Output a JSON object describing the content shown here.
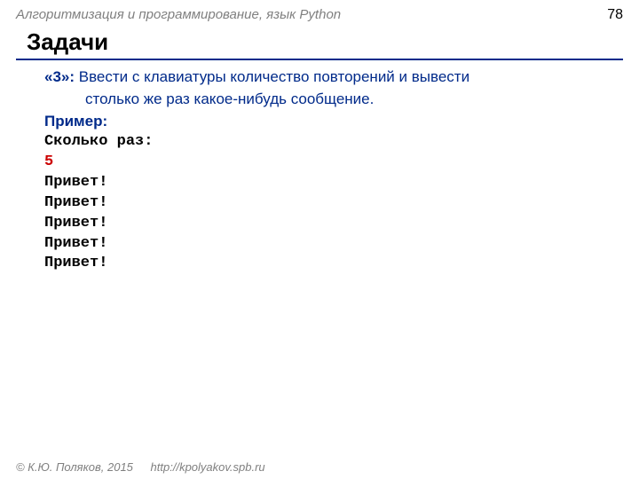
{
  "header": {
    "title": "Алгоритмизация и программирование, язык Python",
    "page_number": "78"
  },
  "section_title": "Задачи",
  "task": {
    "marker": "«3»:",
    "desc_line1": " Ввести с клавиатуры количество повторений и вывести",
    "desc_line2": "столько же раз какое-нибудь сообщение."
  },
  "example": {
    "label": "Пример:",
    "prompt": "Сколько раз:",
    "input": "5",
    "outputs": [
      "Привет!",
      "Привет!",
      "Привет!",
      "Привет!",
      "Привет!"
    ]
  },
  "footer": {
    "copyright": "© К.Ю. Поляков, 2015",
    "url": "http://kpolyakov.spb.ru"
  }
}
